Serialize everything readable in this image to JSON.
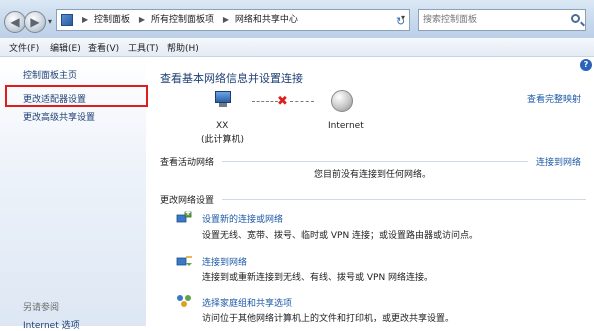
{
  "breadcrumb": [
    "控制面板",
    "所有控制面板项",
    "网络和共享中心"
  ],
  "search": {
    "placeholder": "搜索控制面板"
  },
  "menu": [
    "文件(F)",
    "编辑(E)",
    "查看(V)",
    "工具(T)",
    "帮助(H)"
  ],
  "sidebar": {
    "items": [
      "控制面板主页",
      "更改适配器设置",
      "更改高级共享设置"
    ],
    "see_also_title": "另请参阅",
    "bottom_item": "Internet 选项"
  },
  "main": {
    "heading": "查看基本网络信息并设置连接",
    "view_full_map": "查看完整映射",
    "computer_name": "XX",
    "computer_sub": "(此计算机)",
    "internet": "Internet",
    "active_title": "查看活动网络",
    "connect_link": "连接到网络",
    "no_connection": "您目前没有连接到任何网络。",
    "change_title": "更改网络设置",
    "tasks": [
      {
        "link": "设置新的连接或网络",
        "desc": "设置无线、宽带、拨号、临时或 VPN 连接；或设置路由器或访问点。"
      },
      {
        "link": "连接到网络",
        "desc": "连接到或重新连接到无线、有线、拨号或 VPN 网络连接。"
      },
      {
        "link": "选择家庭组和共享选项",
        "desc": "访问位于其他网络计算机上的文件和打印机，或更改共享设置。"
      }
    ]
  },
  "colors": {
    "highlight_border": "#e01d1d",
    "link": "#1e5aa8"
  }
}
